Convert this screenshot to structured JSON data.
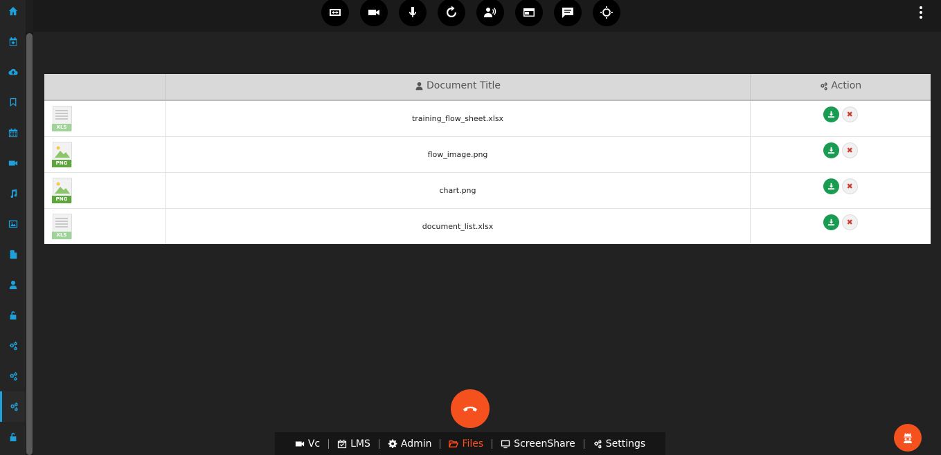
{
  "table": {
    "headers": {
      "icon": "",
      "title": "Document Title",
      "action": "Action"
    },
    "rows": [
      {
        "type": "XLS",
        "title": "training_flow_sheet.xlsx"
      },
      {
        "type": "PNG",
        "title": "flow_image.png"
      },
      {
        "type": "PNG",
        "title": "chart.png"
      },
      {
        "type": "XLS",
        "title": "document_list.xlsx"
      }
    ]
  },
  "bottom_nav": {
    "vc": "Vc",
    "lms": "LMS",
    "admin": "Admin",
    "files": "Files",
    "screenshare": "ScreenShare",
    "settings": "Settings",
    "active": "Files"
  },
  "colors": {
    "accent": "#1ea0d9",
    "call_end": "#f4511e",
    "download": "#1a9b52",
    "delete": "#d03a2e",
    "active_nav": "#ff4c1a"
  },
  "icons": {
    "sidebar": [
      "home-icon",
      "calendar-plus-icon",
      "cloud-upload-icon",
      "bookmark-icon",
      "calendar-icon",
      "video-icon",
      "music-icon",
      "image-icon",
      "file-icon",
      "user-icon",
      "unlock-icon",
      "cogs-icon",
      "cogs-icon",
      "cogs-icon",
      "unlock-icon"
    ],
    "topbar": [
      "expand-arrows-icon",
      "video-camera-icon",
      "microphone-icon",
      "refresh-icon",
      "speaker-user-icon",
      "window-icon",
      "chat-icon",
      "crosshair-icon"
    ]
  }
}
